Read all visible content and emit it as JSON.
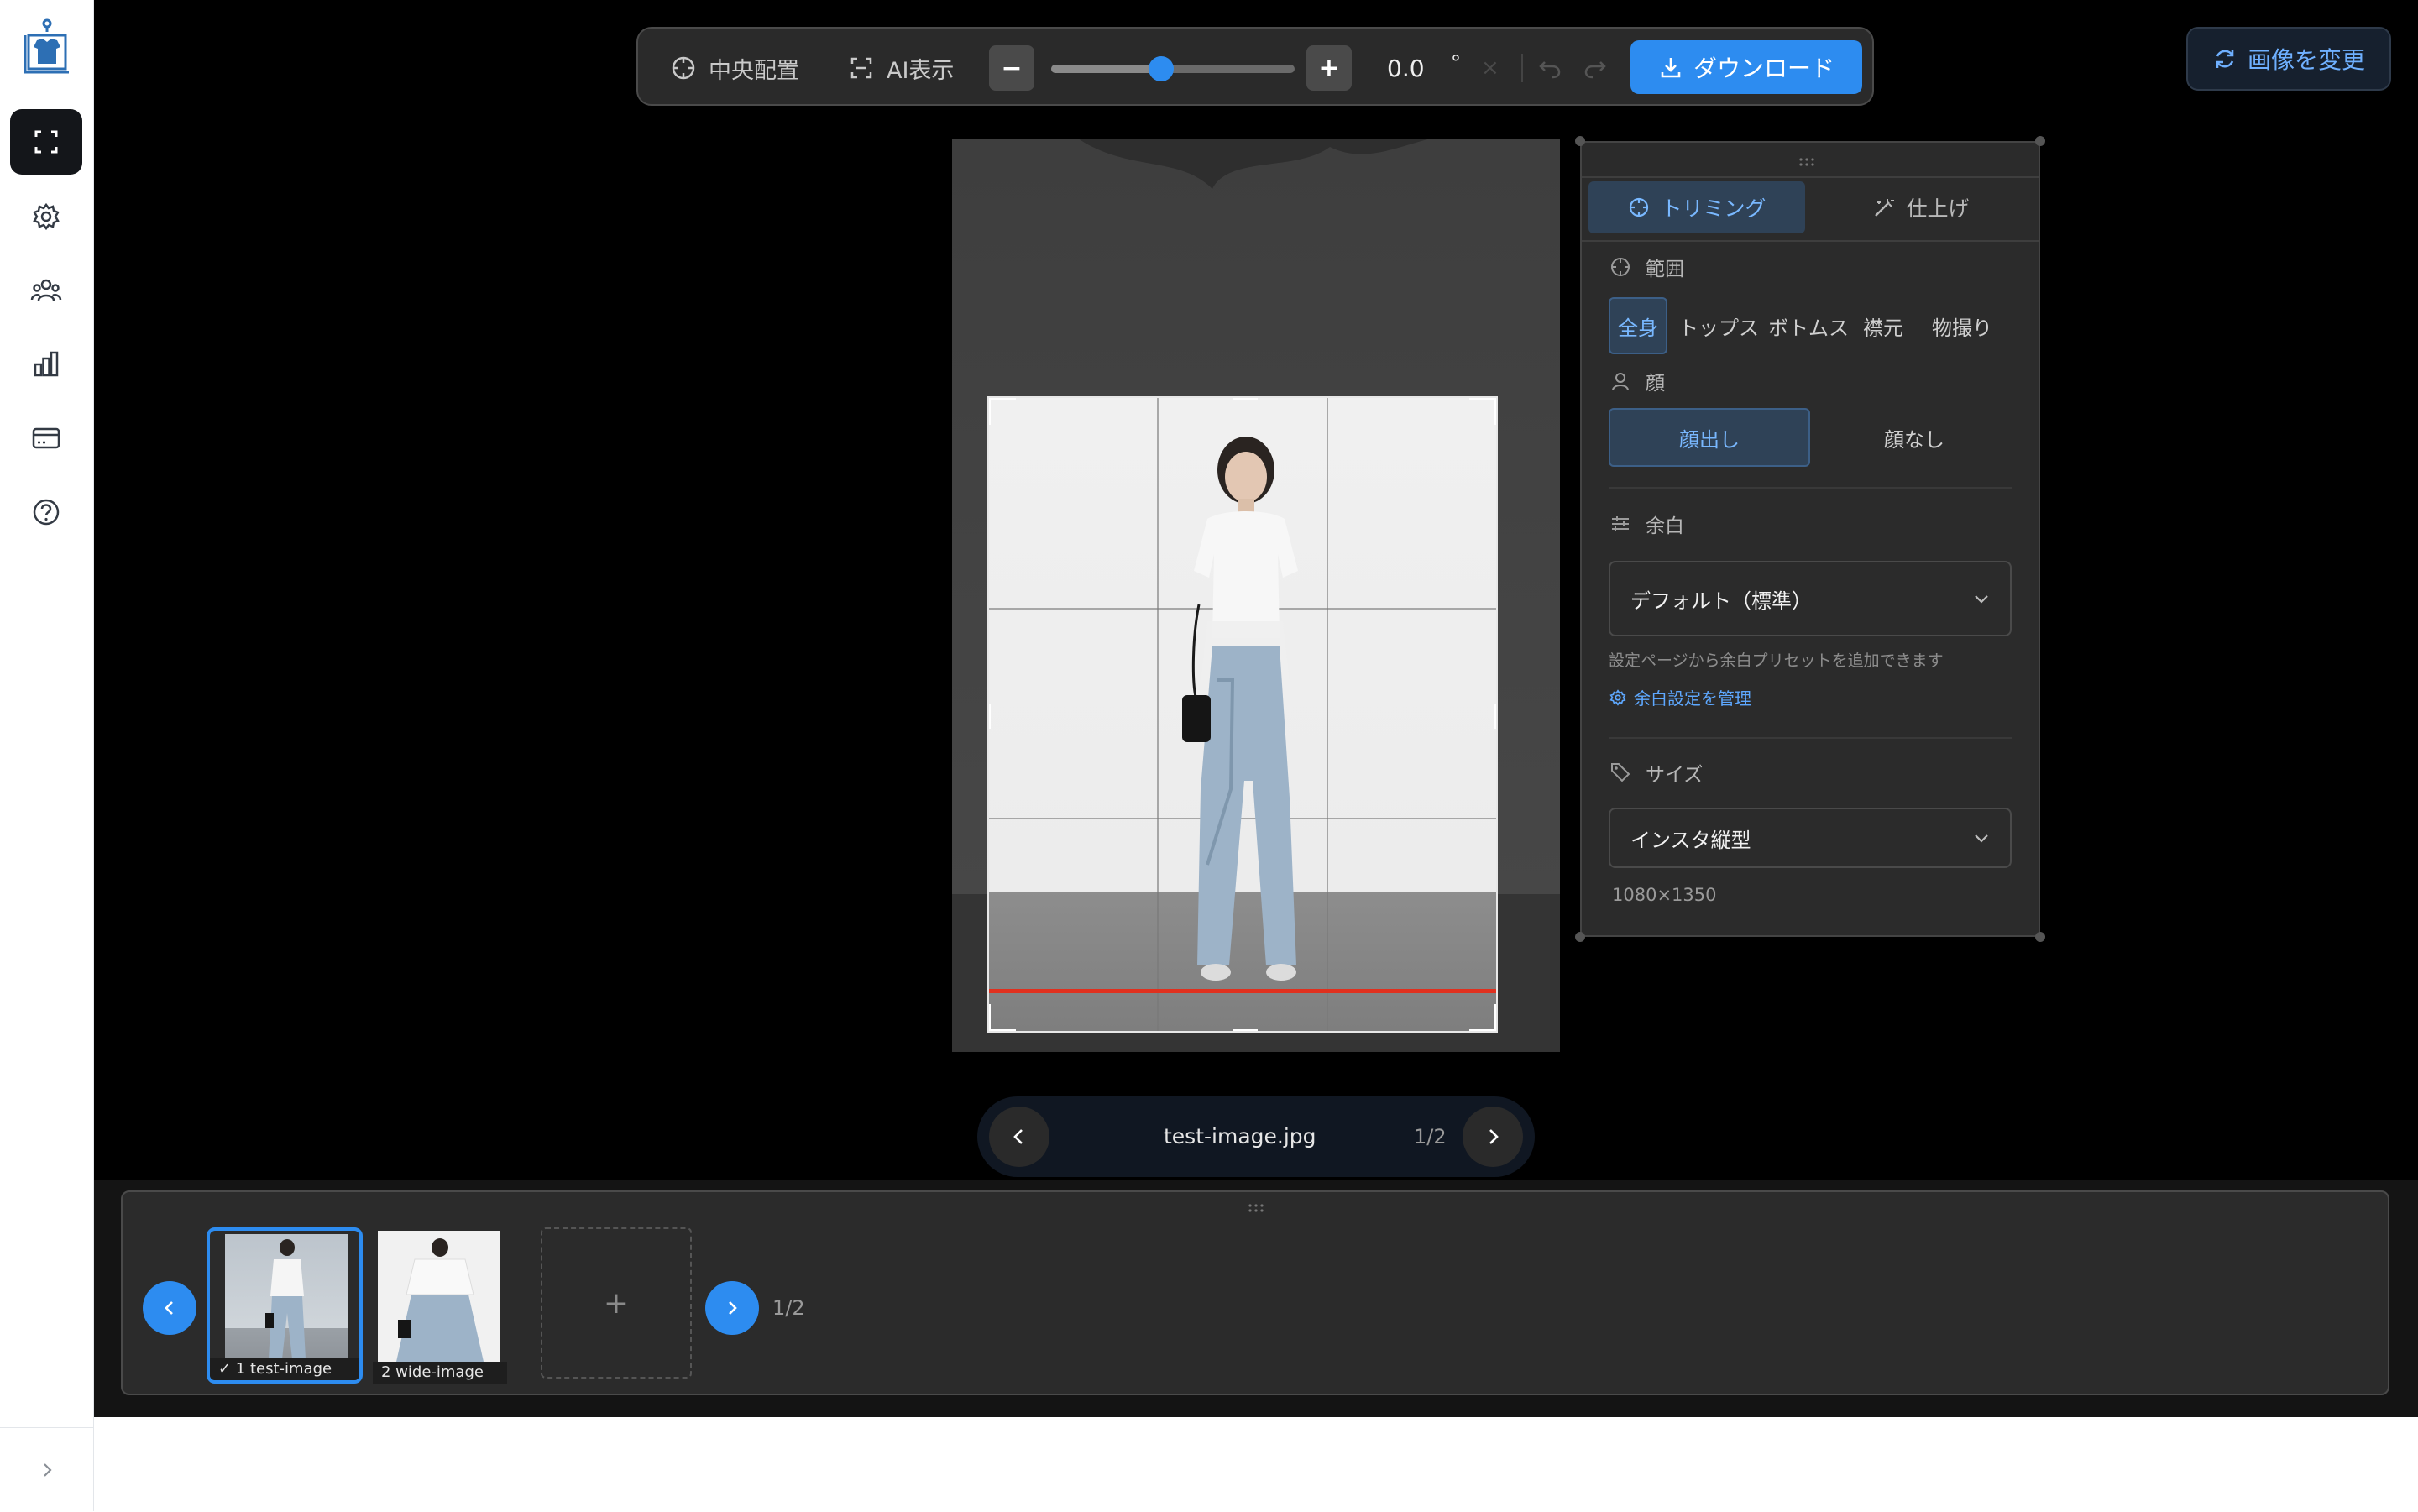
{
  "toolbar": {
    "center_label": "中央配置",
    "ai_label": "AI表示",
    "minus_label": "−",
    "plus_label": "+",
    "rotation_value": "0.0",
    "rotation_unit": "°",
    "clear_label": "×",
    "download_label": "ダウンロード",
    "zoom_level": 0.45
  },
  "change_image_label": "画像を変更",
  "sidebar": {
    "items": [
      {
        "name": "fullscreen",
        "active": true
      },
      {
        "name": "settings"
      },
      {
        "name": "users"
      },
      {
        "name": "analytics"
      },
      {
        "name": "billing"
      },
      {
        "name": "help"
      }
    ]
  },
  "panel": {
    "tabs": [
      {
        "label": "トリミング",
        "active": true
      },
      {
        "label": "仕上げ"
      }
    ],
    "range": {
      "label": "範囲",
      "options": [
        "全身",
        "トップス",
        "ボトムス",
        "襟元",
        "物撮り"
      ],
      "selected": "全身"
    },
    "face": {
      "label": "顔",
      "options": [
        "顔出し",
        "顔なし"
      ],
      "selected": "顔出し"
    },
    "margin": {
      "label": "余白",
      "value": "デフォルト（標準）",
      "hint": "設定ページから余白プリセットを追加できます",
      "manage_link": "余白設定を管理"
    },
    "size": {
      "label": "サイズ",
      "value": "インスタ縦型",
      "dimensions": "1080×1350"
    }
  },
  "file_nav": {
    "filename": "test-image.jpg",
    "page": "1/2"
  },
  "strip": {
    "thumbs": [
      {
        "caption": "✓ 1 test-image",
        "selected": true
      },
      {
        "caption": "2 wide-image",
        "selected": false
      }
    ],
    "add_label": "+",
    "page": "1/2"
  },
  "colors": {
    "accent": "#2d8cf0",
    "guide_line": "#e0301e",
    "panel_bg": "#2b2b2b",
    "stage_bg": "#000000"
  },
  "icons": [
    "app-logo-icon",
    "fullscreen-icon",
    "gear-icon",
    "users-icon",
    "chart-icon",
    "card-icon",
    "help-icon",
    "chevron-right-icon",
    "crosshair-icon",
    "scan-icon",
    "download-icon",
    "refresh-icon",
    "undo-icon",
    "redo-icon",
    "wand-icon",
    "person-icon",
    "sliders-icon",
    "tag-icon",
    "chevron-down-icon",
    "chevron-left-icon"
  ]
}
